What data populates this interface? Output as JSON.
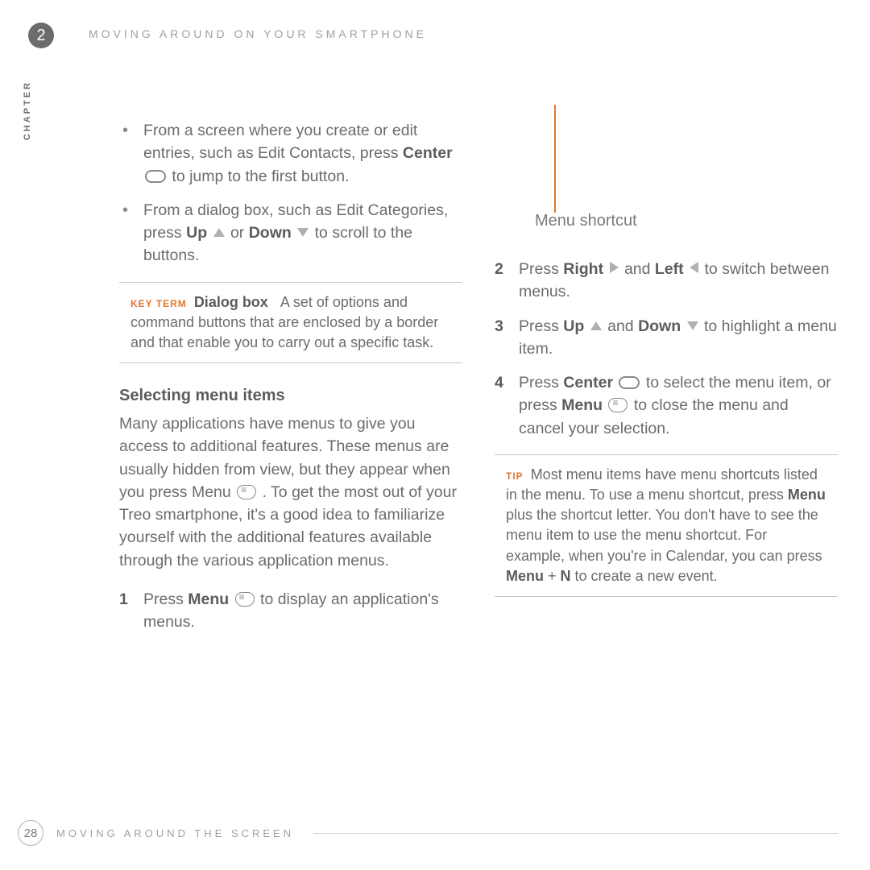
{
  "header": {
    "chapter_number": "2",
    "chapter_title": "MOVING AROUND ON YOUR SMARTPHONE",
    "chapter_label": "CHAPTER"
  },
  "left_col": {
    "bullets": {
      "b1a": "From a screen where you create or edit entries, such as Edit Contacts, press ",
      "b1_center": "Center",
      "b1b": " to jump to the first button.",
      "b2a": "From a dialog box, such as Edit Categories, press ",
      "b2_up": "Up",
      "b2_or": " or ",
      "b2_down": "Down",
      "b2b": " to scroll to the buttons."
    },
    "keyterm": {
      "label": "KEY TERM",
      "term": "Dialog box",
      "text": "A set of options and command buttons that are enclosed by a border and that enable you to carry out a specific task."
    },
    "heading": "Selecting menu items",
    "para1a": "Many applications have menus to give you access to additional features. These menus are usually hidden from view, but they appear when you press Menu ",
    "para1b": ". To get the most out of your Treo smartphone, it's a good idea to familiarize yourself with the additional features available through the various application menus.",
    "step1a": "Press ",
    "step1_menu": "Menu",
    "step1b": " to display an application's menus."
  },
  "right_col": {
    "ms_label": "Menu shortcut",
    "s2a": "Press ",
    "s2_right": "Right",
    "s2_and": " and ",
    "s2_left": "Left",
    "s2b": " to switch between menus.",
    "s3a": "Press ",
    "s3_up": "Up",
    "s3_and": " and ",
    "s3_down": "Down",
    "s3b": " to highlight a menu item.",
    "s4a": "Press ",
    "s4_center": "Center",
    "s4b": " to select the menu item, or press ",
    "s4_menu": "Menu",
    "s4c": " to close the menu and cancel your selection.",
    "tip": {
      "label": "TIP",
      "t1": "Most menu items have menu shortcuts listed in the menu. To use a menu shortcut, press ",
      "t_menu": "Menu",
      "t2": " plus the shortcut letter. You don't have to see the menu item to use the menu shortcut. For example, when you're in Calendar, you can press ",
      "t_menu2": "Menu",
      "t_plus": " + ",
      "t_n": "N",
      "t3": " to create a new event."
    }
  },
  "footer": {
    "page": "28",
    "text": "MOVING AROUND THE SCREEN"
  }
}
